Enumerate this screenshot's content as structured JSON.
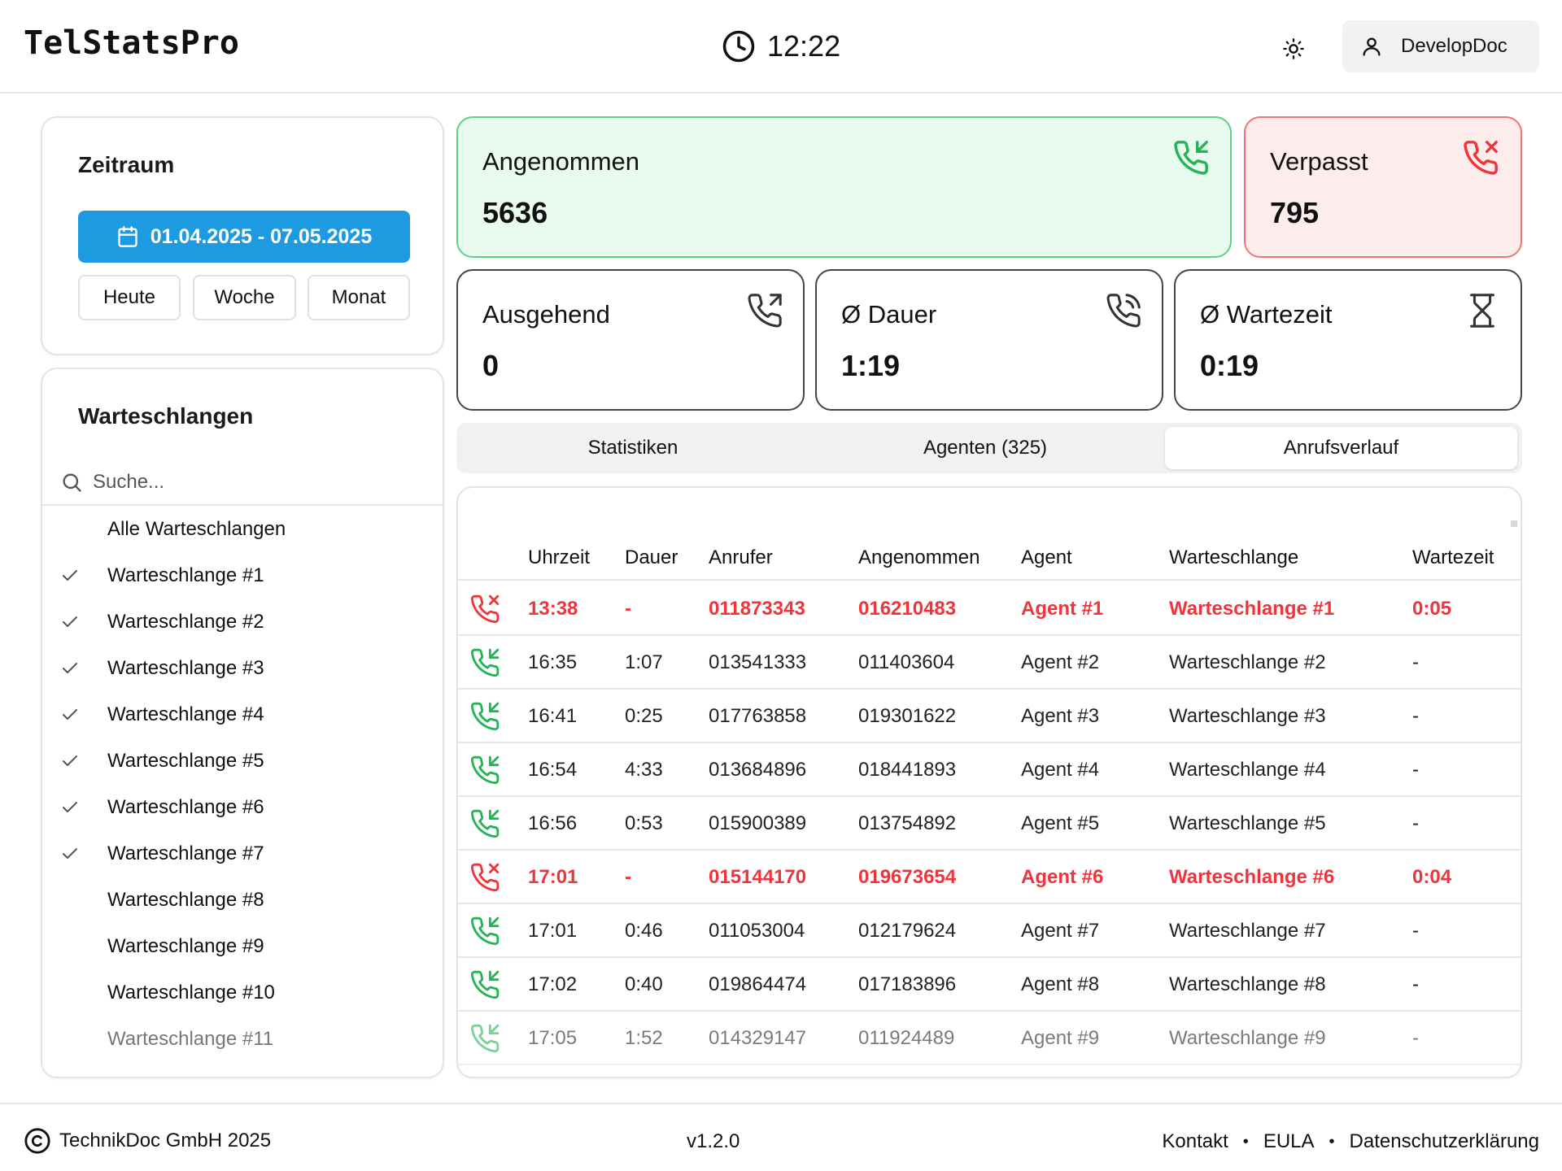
{
  "header": {
    "app_title": "TelStatsPro",
    "time": "12:22",
    "user": "DevelopDoc"
  },
  "zeitraum": {
    "title": "Zeitraum",
    "range": "01.04.2025 - 07.05.2025",
    "quick": [
      "Heute",
      "Woche",
      "Monat"
    ]
  },
  "queues": {
    "title": "Warteschlangen",
    "search_placeholder": "Suche...",
    "items": [
      {
        "label": "Alle Warteschlangen",
        "checked": false
      },
      {
        "label": "Warteschlange #1",
        "checked": true
      },
      {
        "label": "Warteschlange #2",
        "checked": true
      },
      {
        "label": "Warteschlange #3",
        "checked": true
      },
      {
        "label": "Warteschlange #4",
        "checked": true
      },
      {
        "label": "Warteschlange #5",
        "checked": true
      },
      {
        "label": "Warteschlange #6",
        "checked": true
      },
      {
        "label": "Warteschlange #7",
        "checked": true
      },
      {
        "label": "Warteschlange #8",
        "checked": false
      },
      {
        "label": "Warteschlange #9",
        "checked": false
      },
      {
        "label": "Warteschlange #10",
        "checked": false
      },
      {
        "label": "Warteschlange #11",
        "checked": false
      }
    ]
  },
  "stats": {
    "accepted": {
      "label": "Angenommen",
      "value": "5636",
      "icon": "phone-incoming-icon"
    },
    "missed": {
      "label": "Verpasst",
      "value": "795",
      "icon": "phone-missed-icon"
    },
    "outgoing": {
      "label": "Ausgehend",
      "value": "0",
      "icon": "phone-outgoing-icon"
    },
    "duration": {
      "label": "Ø Dauer",
      "value": "1:19",
      "icon": "phone-call-icon"
    },
    "wait": {
      "label": "Ø Wartezeit",
      "value": "0:19",
      "icon": "hourglass-icon"
    }
  },
  "tabs": [
    {
      "label": "Statistiken",
      "active": false
    },
    {
      "label": "Agenten (325)",
      "active": false
    },
    {
      "label": "Anrufsverlauf",
      "active": true
    }
  ],
  "table": {
    "columns": [
      "Uhrzeit",
      "Dauer",
      "Anrufer",
      "Angenommen",
      "Agent",
      "Warteschlange",
      "Wartezeit"
    ],
    "rows": [
      {
        "status": "missed",
        "cells": [
          "13:38",
          "-",
          "011873343",
          "016210483",
          "Agent #1",
          "Warteschlange #1",
          "0:05"
        ]
      },
      {
        "status": "accepted",
        "cells": [
          "16:35",
          "1:07",
          "013541333",
          "011403604",
          "Agent #2",
          "Warteschlange #2",
          "-"
        ]
      },
      {
        "status": "accepted",
        "cells": [
          "16:41",
          "0:25",
          "017763858",
          "019301622",
          "Agent #3",
          "Warteschlange #3",
          "-"
        ]
      },
      {
        "status": "accepted",
        "cells": [
          "16:54",
          "4:33",
          "013684896",
          "018441893",
          "Agent #4",
          "Warteschlange #4",
          "-"
        ]
      },
      {
        "status": "accepted",
        "cells": [
          "16:56",
          "0:53",
          "015900389",
          "013754892",
          "Agent #5",
          "Warteschlange #5",
          "-"
        ]
      },
      {
        "status": "missed",
        "cells": [
          "17:01",
          "-",
          "015144170",
          "019673654",
          "Agent #6",
          "Warteschlange #6",
          "0:04"
        ]
      },
      {
        "status": "accepted",
        "cells": [
          "17:01",
          "0:46",
          "011053004",
          "012179624",
          "Agent #7",
          "Warteschlange #7",
          "-"
        ]
      },
      {
        "status": "accepted",
        "cells": [
          "17:02",
          "0:40",
          "019864474",
          "017183896",
          "Agent #8",
          "Warteschlange #8",
          "-"
        ]
      },
      {
        "status": "accepted",
        "cells": [
          "17:05",
          "1:52",
          "014329147",
          "011924489",
          "Agent #9",
          "Warteschlange #9",
          "-"
        ]
      }
    ]
  },
  "footer": {
    "copyright": "TechnikDoc GmbH 2025",
    "version": "v1.2.0",
    "links": [
      "Kontakt",
      "EULA",
      "Datenschutzerklärung"
    ]
  },
  "colors": {
    "accent": "#1e9be0",
    "green": "#22b455",
    "red": "#f0343c",
    "green_bg": "#e9faee",
    "red_bg": "#fdecec"
  }
}
